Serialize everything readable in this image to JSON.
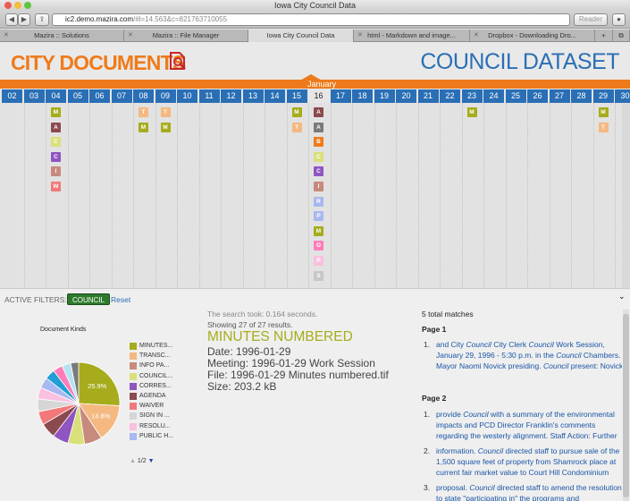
{
  "browser": {
    "window_title": "Iowa City Council Data",
    "url_host": "ic2.demo.mazira.com",
    "url_rest": "/#l=14.563&c=821763710055",
    "reader_label": "Reader",
    "tabs": [
      "Mazira :: Solutions",
      "Mazira :: File Manager",
      "Iowa City Council Data",
      "html - Markdown and image...",
      "Dropbox - Downloading Dro..."
    ],
    "new_tab_label": "+"
  },
  "header": {
    "left_logo": "CITY DOCUMENTS",
    "right_logo": "COUNCIL DATASET"
  },
  "timeline": {
    "month": "January",
    "days": [
      "02",
      "03",
      "04",
      "05",
      "06",
      "07",
      "08",
      "09",
      "10",
      "11",
      "12",
      "13",
      "14",
      "15",
      "16",
      "17",
      "18",
      "19",
      "20",
      "21",
      "22",
      "23",
      "24",
      "25",
      "26",
      "27",
      "28",
      "29",
      "30"
    ],
    "selected_day": "16",
    "markers": [
      {
        "day": "04",
        "items": [
          [
            "M",
            "#a6ac1c"
          ],
          [
            "A",
            "#8b4a4f"
          ],
          [
            "C",
            "#d9e07a"
          ],
          [
            "C",
            "#8f55c0"
          ],
          [
            "I",
            "#c78a7c"
          ],
          [
            "W",
            "#f2787a"
          ]
        ]
      },
      {
        "day": "08",
        "items": [
          [
            "T",
            "#f5b880"
          ],
          [
            "M",
            "#a6ac1c"
          ]
        ]
      },
      {
        "day": "09",
        "items": [
          [
            "T",
            "#f5b880"
          ],
          [
            "M",
            "#a6ac1c"
          ]
        ]
      },
      {
        "day": "15",
        "items": [
          [
            "M",
            "#a6ac1c"
          ],
          [
            "T",
            "#f5b880"
          ]
        ]
      },
      {
        "day": "16",
        "items": [
          [
            "A",
            "#8b4a4f"
          ],
          [
            "A",
            "#7a7a7a"
          ],
          [
            "B",
            "#ef7b1a"
          ],
          [
            "C",
            "#d9e07a"
          ],
          [
            "C",
            "#8f55c0"
          ],
          [
            "I",
            "#c78a7c"
          ],
          [
            "R",
            "#a8b8f0"
          ],
          [
            "P",
            "#a8b8f0"
          ],
          [
            "M",
            "#a6ac1c"
          ],
          [
            "O",
            "#ff7eb9"
          ],
          [
            "P",
            "#f9c0df"
          ],
          [
            "S",
            "#c7c7c7"
          ]
        ]
      },
      {
        "day": "23",
        "items": [
          [
            "M",
            "#a6ac1c"
          ]
        ]
      },
      {
        "day": "29",
        "items": [
          [
            "M",
            "#a6ac1c"
          ],
          [
            "T",
            "#f5b880"
          ]
        ]
      }
    ]
  },
  "filters": {
    "label": "ACTIVE FILTERS:",
    "active": "COUNCIL",
    "reset": "Reset"
  },
  "document_kinds": {
    "title": "Document Kinds",
    "pager": "1/2",
    "legend": [
      {
        "label": "MINUTES...",
        "color": "#a6ac1c"
      },
      {
        "label": "TRANSC...",
        "color": "#f5b880"
      },
      {
        "label": "INFO PA...",
        "color": "#c78a7c"
      },
      {
        "label": "COUNCIL...",
        "color": "#d9e07a"
      },
      {
        "label": "CORRES...",
        "color": "#8f55c0"
      },
      {
        "label": "AGENDA",
        "color": "#8b4a4f"
      },
      {
        "label": "WAIVER",
        "color": "#f2787a"
      },
      {
        "label": "SIGN IN ...",
        "color": "#d6d6d6"
      },
      {
        "label": "RESOLU...",
        "color": "#f9c0df"
      },
      {
        "label": "PUBLIC H...",
        "color": "#a8b8f0"
      }
    ],
    "chart_data": {
      "type": "pie",
      "labels": [
        "MINUTES...",
        "TRANSC...",
        "INFO PA...",
        "COUNCIL...",
        "CORRES...",
        "AGENDA",
        "WAIVER",
        "SIGN IN ...",
        "RESOLU...",
        "PUBLIC H...",
        "other-1",
        "other-2",
        "other-3",
        "other-4"
      ],
      "values": [
        25.9,
        14.8,
        7.0,
        6.5,
        6.3,
        6.0,
        5.3,
        5.0,
        4.5,
        4.3,
        4.0,
        3.8,
        3.5,
        3.1
      ],
      "colors": [
        "#a6ac1c",
        "#f5b880",
        "#c78a7c",
        "#d9e07a",
        "#8f55c0",
        "#8b4a4f",
        "#f2787a",
        "#d6d6d6",
        "#f9c0df",
        "#a8b8f0",
        "#1f9fd5",
        "#ff7eb9",
        "#b7e3f0",
        "#7a7a7a"
      ],
      "data_labels": [
        "25.9%",
        "14.8%"
      ]
    }
  },
  "results": {
    "search_time": "The search took: 0.164 seconds.",
    "showing": "Showing 27 of 27 results.",
    "title": "MINUTES NUMBERED",
    "date": "Date: 1996-01-29",
    "meeting": "Meeting: 1996-01-29 Work Session",
    "file": "File: 1996-01-29 Minutes numbered.tif",
    "size": "Size: 203.2 kB"
  },
  "matches": {
    "total": "5 total matches",
    "page1": "Page 1",
    "page2": "Page 2",
    "p1_items": [
      {
        "num": "1.",
        "html": "and City <i>Council</i> City Clerk <i>Council</i> Work Session, January 29, 1996 - 5:30 p.m. in the <i>Council</i> Chambers. Mayor Naomi Novick presiding. <i>Council</i> present: Novick"
      }
    ],
    "p2_items": [
      {
        "num": "1.",
        "html": "provide <i>Council</i> with a summary of the environmental impacts and PCD Director Franklin's comments regarding the westerly alignment. Staff Action: Further"
      },
      {
        "num": "2.",
        "html": "information. <i>Council</i> directed staff to pursue sale of the 1,500 square feet of property from Shamrock place at current fair market value to Court Hill Condominium"
      },
      {
        "num": "3.",
        "html": "proposal. <i>Council</i> directed staff to amend the resolution to state \"participating in\" the programs and"
      }
    ]
  }
}
